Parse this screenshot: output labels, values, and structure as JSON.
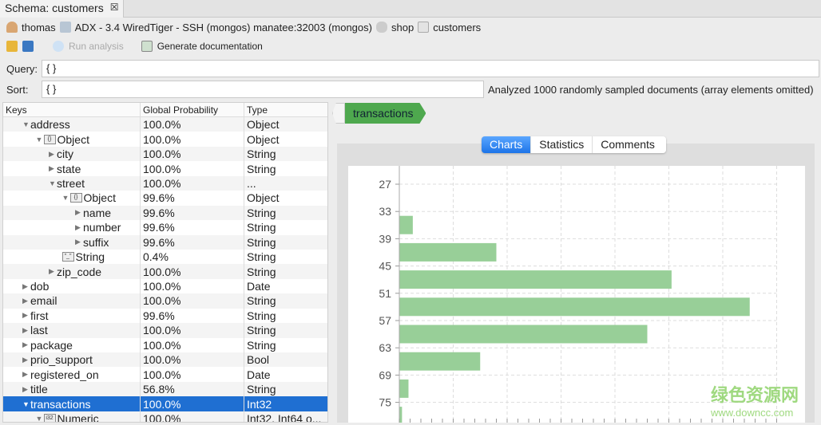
{
  "tab": {
    "title": "Schema: customers",
    "close": "☒"
  },
  "breadcrumb": {
    "user": "thomas",
    "connection": "ADX - 3.4 WiredTiger - SSH (mongos) manatee:32003 (mongos)",
    "database": "shop",
    "collection": "customers"
  },
  "toolbar": {
    "run": "Run analysis",
    "docs": "Generate documentation"
  },
  "query": {
    "label": "Query:",
    "value": "{ }"
  },
  "sort": {
    "label": "Sort:",
    "value": "{ }"
  },
  "status": "Analyzed 1000 randomly sampled documents (array elements omitted)",
  "tree": {
    "headers": [
      "Keys",
      "Global Probability",
      "Type"
    ],
    "rows": [
      {
        "key": "address",
        "level": 0,
        "arrow": "down",
        "icon": "",
        "prob": "100.0%",
        "type": "Object"
      },
      {
        "key": "Object",
        "level": 1,
        "arrow": "down",
        "icon": "{}",
        "prob": "100.0%",
        "type": "Object"
      },
      {
        "key": "city",
        "level": 2,
        "arrow": "right",
        "icon": "",
        "prob": "100.0%",
        "type": "String"
      },
      {
        "key": "state",
        "level": 2,
        "arrow": "right",
        "icon": "",
        "prob": "100.0%",
        "type": "String"
      },
      {
        "key": "street",
        "level": 2,
        "arrow": "down",
        "icon": "",
        "prob": "100.0%",
        "type": "..."
      },
      {
        "key": "Object",
        "level": 3,
        "arrow": "down",
        "icon": "{}",
        "prob": "99.6%",
        "type": "Object"
      },
      {
        "key": "name",
        "level": 4,
        "arrow": "right",
        "icon": "",
        "prob": "99.6%",
        "type": "String"
      },
      {
        "key": "number",
        "level": 4,
        "arrow": "right",
        "icon": "",
        "prob": "99.6%",
        "type": "String"
      },
      {
        "key": "suffix",
        "level": 4,
        "arrow": "right",
        "icon": "",
        "prob": "99.6%",
        "type": "String"
      },
      {
        "key": "String",
        "level": 3,
        "arrow": "none",
        "icon": "\"_\"",
        "prob": "0.4%",
        "type": "String"
      },
      {
        "key": "zip_code",
        "level": 2,
        "arrow": "right",
        "icon": "",
        "prob": "100.0%",
        "type": "String"
      },
      {
        "key": "dob",
        "level": 0,
        "arrow": "right",
        "icon": "",
        "prob": "100.0%",
        "type": "Date"
      },
      {
        "key": "email",
        "level": 0,
        "arrow": "right",
        "icon": "",
        "prob": "100.0%",
        "type": "String"
      },
      {
        "key": "first",
        "level": 0,
        "arrow": "right",
        "icon": "",
        "prob": "99.6%",
        "type": "String"
      },
      {
        "key": "last",
        "level": 0,
        "arrow": "right",
        "icon": "",
        "prob": "100.0%",
        "type": "String"
      },
      {
        "key": "package",
        "level": 0,
        "arrow": "right",
        "icon": "",
        "prob": "100.0%",
        "type": "String"
      },
      {
        "key": "prio_support",
        "level": 0,
        "arrow": "right",
        "icon": "",
        "prob": "100.0%",
        "type": "Bool"
      },
      {
        "key": "registered_on",
        "level": 0,
        "arrow": "right",
        "icon": "",
        "prob": "100.0%",
        "type": "Date"
      },
      {
        "key": "title",
        "level": 0,
        "arrow": "right",
        "icon": "",
        "prob": "56.8%",
        "type": "String"
      },
      {
        "key": "transactions",
        "level": 0,
        "arrow": "down",
        "icon": "",
        "prob": "100.0%",
        "type": "Int32",
        "selected": true
      },
      {
        "key": "Numeric",
        "level": 1,
        "arrow": "down",
        "icon": "i32",
        "prob": "100.0%",
        "type": "Int32, Int64 o..."
      }
    ]
  },
  "path": {
    "item": "transactions"
  },
  "view_tabs": {
    "charts": "Charts",
    "statistics": "Statistics",
    "comments": "Comments",
    "active": "Charts"
  },
  "colors": {
    "bar": "#98cf98",
    "selection": "#1f6fd2",
    "crumb": "#4ea84e"
  },
  "chart_data": {
    "type": "bar",
    "orientation": "horizontal",
    "categories": [
      "27",
      "33",
      "39",
      "45",
      "51",
      "57",
      "63",
      "69",
      "75"
    ],
    "values": [
      0,
      0.25,
      1.8,
      5.05,
      6.5,
      4.6,
      1.5,
      0.17,
      0.05
    ],
    "xlim": [
      0,
      7
    ],
    "grid": true,
    "title": "",
    "xlabel": "",
    "ylabel": ""
  },
  "watermark": {
    "text": "绿色资源网",
    "url": "www.downcc.com"
  }
}
